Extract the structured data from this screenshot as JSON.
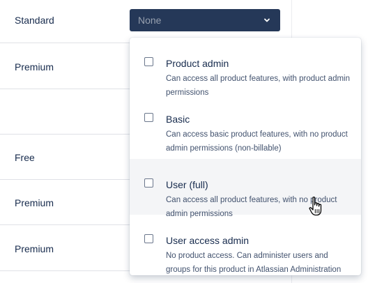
{
  "rows": [
    {
      "plan": "Standard"
    },
    {
      "plan": "Premium"
    },
    {
      "plan": ""
    },
    {
      "plan": "Free"
    },
    {
      "plan": "Premium"
    },
    {
      "plan": "Premium"
    }
  ],
  "role_select": {
    "value": "None",
    "icon": "chevron-down-icon",
    "background": "#253858"
  },
  "role_menu": {
    "options": [
      {
        "title": "Product admin",
        "description": "Can access all product features, with product admin permissions",
        "checked": false
      },
      {
        "title": "Basic",
        "description": "Can access basic product features, with no product admin permissions (non-billable)",
        "checked": false
      },
      {
        "title": "User (full)",
        "description": "Can access all product features, with no product admin permissions",
        "checked": false,
        "hovered": true
      },
      {
        "title": "User access admin",
        "description": "No product access. Can administer users and groups for this product in Atlassian Administration",
        "checked": false
      }
    ]
  },
  "cursor": "hand-pointer"
}
